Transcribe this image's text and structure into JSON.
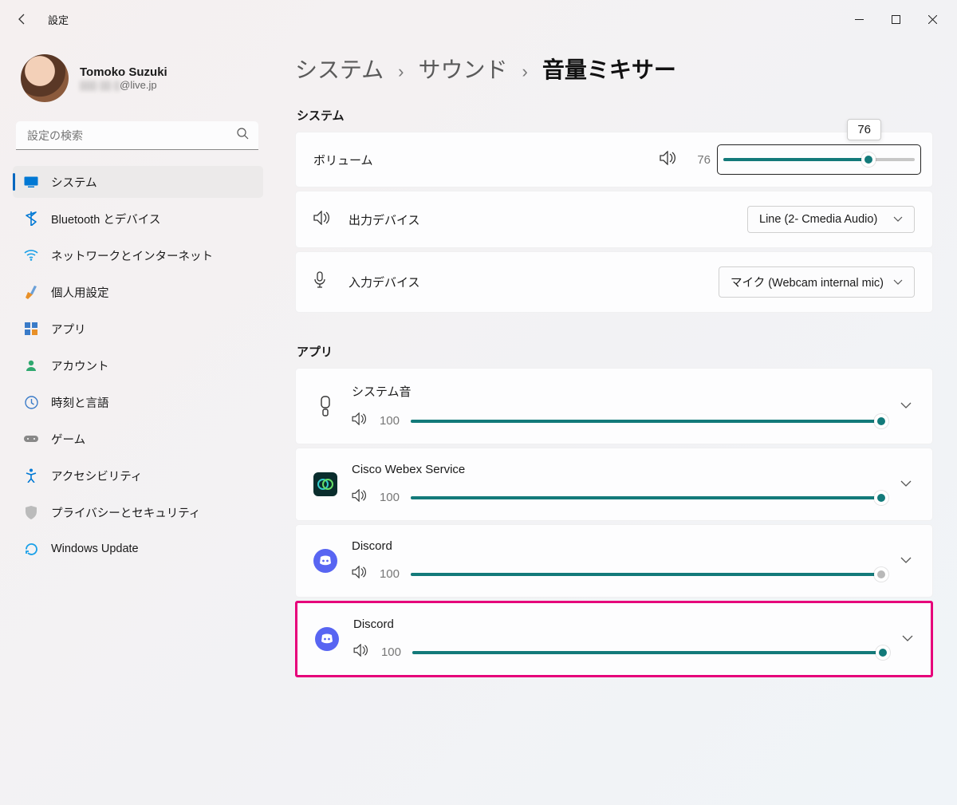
{
  "window": {
    "title": "設定"
  },
  "user": {
    "name": "Tomoko Suzuki",
    "email_hidden": "▯▯▯ ▯▯ ▯",
    "email_suffix": "@live.jp"
  },
  "search": {
    "placeholder": "設定の検索"
  },
  "nav": {
    "items": [
      {
        "label": "システム"
      },
      {
        "label": "Bluetooth とデバイス"
      },
      {
        "label": "ネットワークとインターネット"
      },
      {
        "label": "個人用設定"
      },
      {
        "label": "アプリ"
      },
      {
        "label": "アカウント"
      },
      {
        "label": "時刻と言語"
      },
      {
        "label": "ゲーム"
      },
      {
        "label": "アクセシビリティ"
      },
      {
        "label": "プライバシーとセキュリティ"
      },
      {
        "label": "Windows Update"
      }
    ]
  },
  "breadcrumb": {
    "root": "システム",
    "mid": "サウンド",
    "current": "音量ミキサー"
  },
  "sections": {
    "system": "システム",
    "apps": "アプリ"
  },
  "system_rows": {
    "volume": {
      "label": "ボリューム",
      "value": "76",
      "tooltip": "76",
      "percent": 76
    },
    "output": {
      "label": "出力デバイス",
      "selected": "Line (2- Cmedia Audio)"
    },
    "input": {
      "label": "入力デバイス",
      "selected": "マイク (Webcam internal mic)"
    }
  },
  "apps": [
    {
      "name": "システム音",
      "value": "100",
      "percent": 100,
      "thumb": "teal",
      "icon": "device"
    },
    {
      "name": "Cisco Webex Service",
      "value": "100",
      "percent": 100,
      "thumb": "teal",
      "icon": "webex"
    },
    {
      "name": "Discord",
      "value": "100",
      "percent": 100,
      "thumb": "gray",
      "icon": "discord"
    },
    {
      "name": "Discord",
      "value": "100",
      "percent": 100,
      "thumb": "teal",
      "icon": "discord",
      "highlight": true
    }
  ]
}
